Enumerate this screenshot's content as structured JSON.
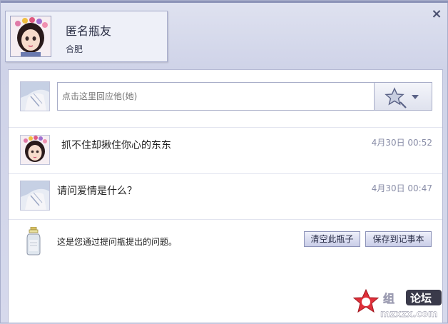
{
  "window": {
    "close_label": "×"
  },
  "profile": {
    "name": "匿名瓶友",
    "city": "合肥"
  },
  "reply": {
    "placeholder": "点击这里回应他(她)"
  },
  "messages": [
    {
      "text": "抓不住却揪住你心的东东",
      "time": "4月30日 00:52",
      "avatar": "female-avatar"
    },
    {
      "text": "请问爱情是什么？",
      "time": "4月30日 00:47",
      "avatar": "male-avatar"
    }
  ],
  "question": {
    "text": "这是您通过提问瓶提出的问题。",
    "clear_button": "清空此瓶子",
    "save_button": "保存到记事本"
  },
  "watermark": {
    "brand": "论坛",
    "site": "mzxzx.com"
  },
  "colors": {
    "accent": "#8c92b8",
    "background": "#c9cde3",
    "time": "#8a8ea8"
  }
}
